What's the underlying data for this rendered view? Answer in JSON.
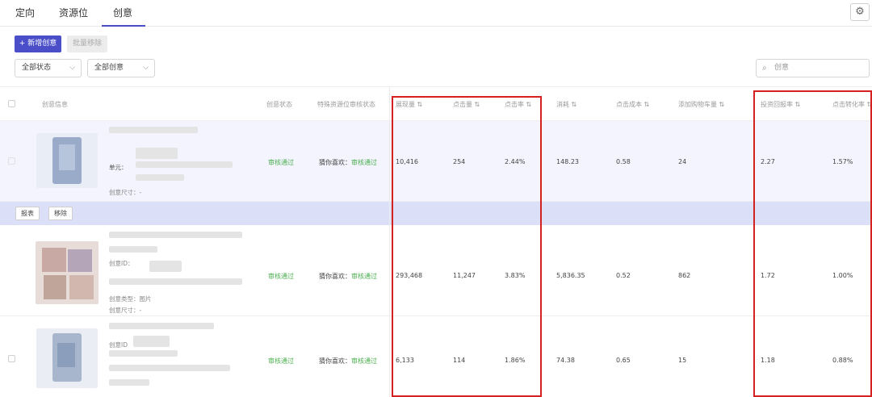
{
  "tabs": [
    {
      "label": "定向",
      "active": false
    },
    {
      "label": "资源位",
      "active": false
    },
    {
      "label": "创意",
      "active": true
    }
  ],
  "toolbar": {
    "add_label": "+ 新增创意",
    "batch_remove_label": "批量移除",
    "status_filter": "全部状态",
    "creative_filter": "全部创意",
    "search_placeholder": "创意"
  },
  "columns": {
    "info": "创意信息",
    "status": "创意状态",
    "audit": "特殊资源位审核状态",
    "impressions": "展现量 ⇅",
    "clicks": "点击量 ⇅",
    "ctr": "点击率 ⇅",
    "cost": "消耗 ⇅",
    "cpc": "点击成本 ⇅",
    "cart": "添加购物车量 ⇅",
    "roi": "投资回报率 ⇅",
    "cvr": "点击转化率 ⇅"
  },
  "row_actions": {
    "report": "报表",
    "remove": "移除"
  },
  "rows": [
    {
      "meta": [
        "单元：",
        "创意尺寸：-"
      ],
      "status": "审核通过",
      "audit_label": "猜你喜欢：",
      "audit_value": "审核通过",
      "impressions": "10,416",
      "clicks": "254",
      "ctr": "2.44%",
      "cost": "148.23",
      "cpc": "0.58",
      "cart": "24",
      "roi": "2.27",
      "cvr": "1.57%"
    },
    {
      "meta": [
        "创意ID：",
        "创意类型：图片",
        "创意尺寸：-"
      ],
      "status": "审核通过",
      "audit_label": "猜你喜欢：",
      "audit_value": "审核通过",
      "impressions": "293,468",
      "clicks": "11,247",
      "ctr": "3.83%",
      "cost": "5,836.35",
      "cpc": "0.52",
      "cart": "862",
      "roi": "1.72",
      "cvr": "1.00%"
    },
    {
      "meta": [
        "创意ID"
      ],
      "status": "审核通过",
      "audit_label": "猜你喜欢：",
      "audit_value": "审核通过",
      "impressions": "6,133",
      "clicks": "114",
      "ctr": "1.86%",
      "cost": "74.38",
      "cpc": "0.65",
      "cart": "15",
      "roi": "1.18",
      "cvr": "0.88%"
    }
  ],
  "colors": {
    "accent": "#4a4fc9",
    "pass": "#4caf50",
    "highlight_box": "#d62121"
  }
}
